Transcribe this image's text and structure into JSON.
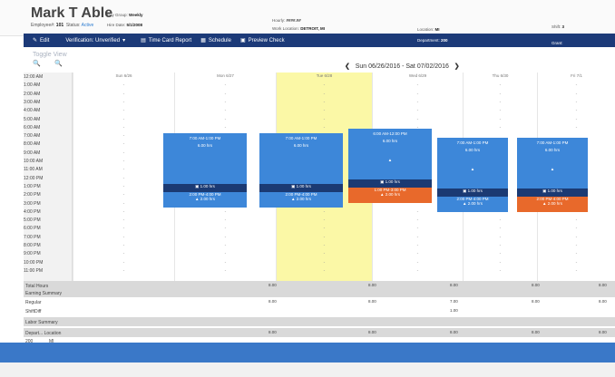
{
  "employee": {
    "name": "Mark T Able",
    "employee_no_label": "Employee#:",
    "employee_no": "101",
    "status_label": "Status:",
    "status": "Active",
    "pay_group_label": "Pay Group:",
    "pay_group": "Weekly",
    "hire_date_label": "Hire Date:",
    "hire_date": "5/1/2008",
    "hourly_label": "Hourly:",
    "hourly": "####.##",
    "work_location_label": "Work Location:",
    "work_location": "DETROIT, MI",
    "location_label": "Location:",
    "location": "MI",
    "department_label": "Department:",
    "department": "200",
    "shift_label": "Shift:",
    "shift": "3",
    "grant_label": "Grant:",
    "grant": ""
  },
  "toolbar": {
    "edit": "Edit",
    "verification": "Verification: Unverified",
    "time_card_report": "Time Card Report",
    "schedule": "Schedule",
    "preview_check": "Preview Check"
  },
  "toggle_view": "Toggle View",
  "week_range": "Sun 06/26/2016 - Sat 07/02/2016",
  "times": [
    "12:00 AM",
    "1:00 AM",
    "2:00 AM",
    "3:00 AM",
    "4:00 AM",
    "5:00 AM",
    "6:00 AM",
    "7:00 AM",
    "8:00 AM",
    "9:00 AM",
    "10:00 AM",
    "11:00 AM",
    "12:00 PM",
    "1:00 PM",
    "2:00 PM",
    "3:00 PM",
    "4:00 PM",
    "5:00 PM",
    "6:00 PM",
    "7:00 PM",
    "8:00 PM",
    "9:00 PM",
    "10:00 PM",
    "11:00 PM"
  ],
  "days": [
    "Sun 6/26",
    "Mon 6/27",
    "Tue 6/28",
    "Wed 6/29",
    "Thu 6/30",
    "Fri 7/1"
  ],
  "shifts": [
    {
      "main_time": "7:00 AM-1:00 PM",
      "main_hrs": "6.00 hrs",
      "lunch": "1.00 hrs",
      "aft_time": "2:00 PM-4:00 PM",
      "aft_hrs": "2.00 hrs"
    },
    {
      "main_time": "7:00 AM-1:00 PM",
      "main_hrs": "6.00 hrs",
      "lunch": "1.00 hrs",
      "aft_time": "2:00 PM-4:00 PM",
      "aft_hrs": "2.00 hrs"
    },
    {
      "main_time": "6:00 AM-12:00 PM",
      "main_hrs": "6.00 hrs",
      "lunch": "1.00 hrs",
      "aft_time": "1:00 PM-3:00 PM",
      "aft_hrs": "2.00 hrs"
    },
    {
      "main_time": "7:00 AM-1:00 PM",
      "main_hrs": "6.00 hrs",
      "lunch": "1.00 hrs",
      "aft_time": "2:00 PM-4:00 PM",
      "aft_hrs": "2.00 hrs"
    },
    {
      "main_time": "7:00 AM-1:00 PM",
      "main_hrs": "6.00 hrs",
      "lunch": "1.00 hrs",
      "aft_time": "2:00 PM-4:00 PM",
      "aft_hrs": "2.00 hrs"
    }
  ],
  "summary": {
    "total_hours": "Total Hours",
    "earning_summary": "Earning Summary",
    "regular": "Regular",
    "shift_diff": "ShiftDiff",
    "labor_summary": "Labor Summary",
    "depart_location": "Depart... Location",
    "dept_val": "200",
    "loc_val": "MI",
    "totals": [
      "8.00",
      "8.00",
      "8.00",
      "8.00",
      "8.00"
    ],
    "regular_vals": [
      "8.00",
      "8.00",
      "7.00",
      "8.00",
      "8.00"
    ],
    "shift_diff_vals": [
      "1.00"
    ],
    "labor_vals": [
      "8.00",
      "8.00",
      "8.00",
      "8.00",
      "8.00"
    ]
  },
  "colors": {
    "navy": "#1c3a78",
    "blue": "#3d87d9",
    "orange": "#e8692b",
    "highlight": "#fbf8a6"
  }
}
